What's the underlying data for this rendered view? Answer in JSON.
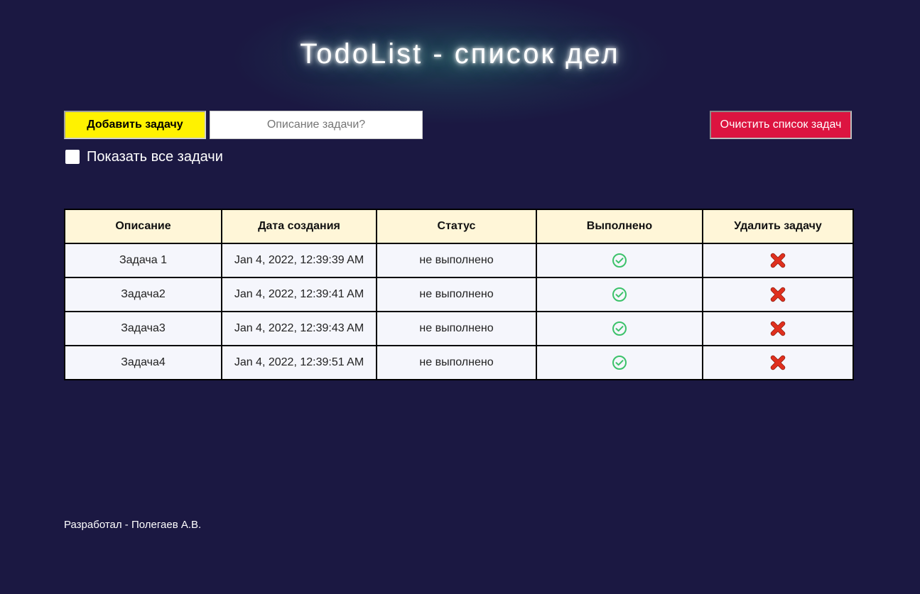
{
  "header": {
    "title": "TodoList - список дел"
  },
  "controls": {
    "add_button_label": "Добавить задачу",
    "description_placeholder": "Описание задачи?",
    "description_value": "",
    "clear_button_label": "Очистить список задач",
    "show_all_label": "Показать все задачи",
    "show_all_checked": false
  },
  "table": {
    "columns": [
      "Описание",
      "Дата создания",
      "Статус",
      "Выполнено",
      "Удалить задачу"
    ],
    "rows": [
      {
        "description": "Задача 1",
        "created": "Jan 4, 2022, 12:39:39 AM",
        "status": "не выполнено",
        "done_icon": "check-circle-icon",
        "delete_icon": "cross-icon"
      },
      {
        "description": "Задача2",
        "created": "Jan 4, 2022, 12:39:41 AM",
        "status": "не выполнено",
        "done_icon": "check-circle-icon",
        "delete_icon": "cross-icon"
      },
      {
        "description": "Задача3",
        "created": "Jan 4, 2022, 12:39:43 AM",
        "status": "не выполнено",
        "done_icon": "check-circle-icon",
        "delete_icon": "cross-icon"
      },
      {
        "description": "Задача4",
        "created": "Jan 4, 2022, 12:39:51 AM",
        "status": "не выполнено",
        "done_icon": "check-circle-icon",
        "delete_icon": "cross-icon"
      }
    ]
  },
  "footer": {
    "text": "Разработал - Полегаев А.В."
  },
  "colors": {
    "background": "#1b1842",
    "add_button": "#fff200",
    "clear_button": "#dc1440",
    "header_row": "#fff6d8",
    "row_background": "#f5f6fc",
    "check_icon": "#3cc26a",
    "cross_icon": "#e0301e"
  }
}
